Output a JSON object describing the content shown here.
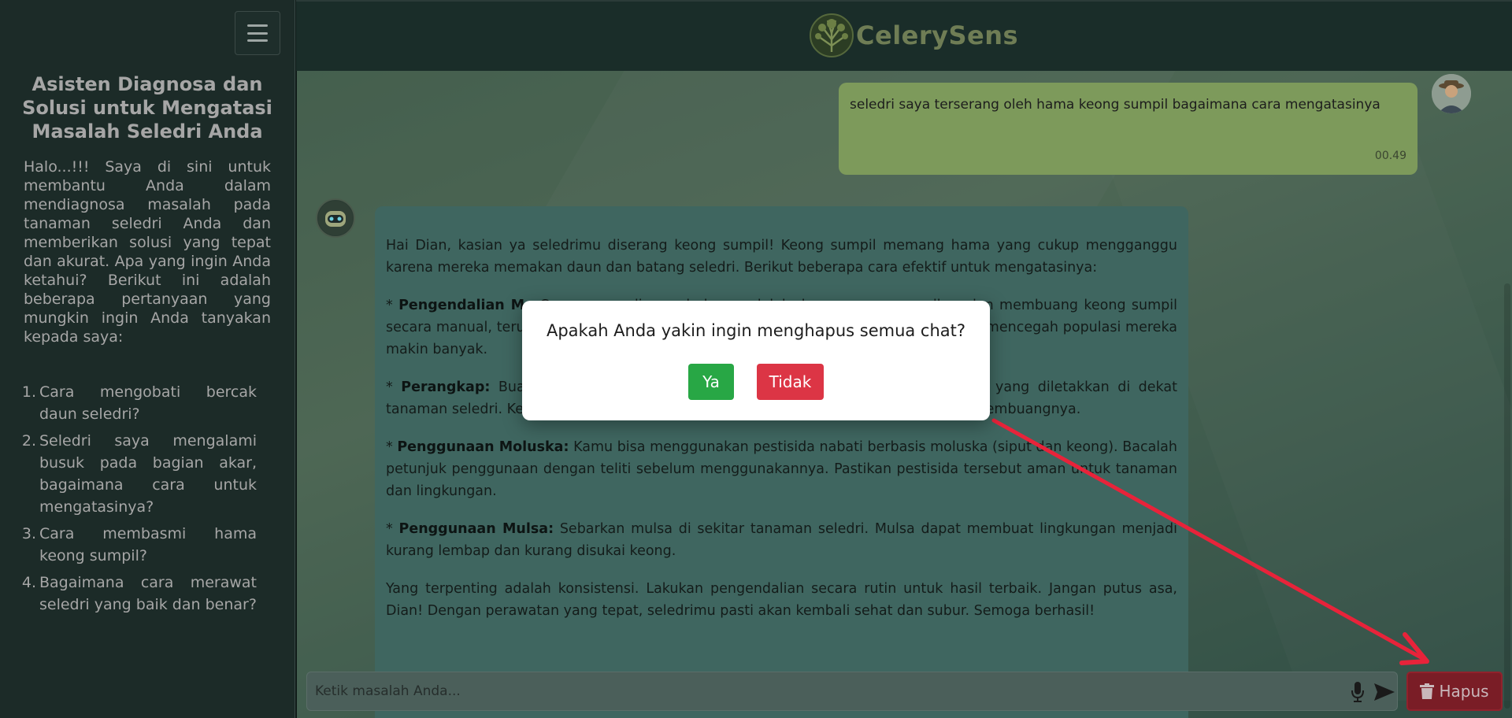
{
  "sidebar": {
    "title": "Asisten Diagnosa dan Solusi untuk Mengatasi Masalah Seledri Anda",
    "intro": "Halo...!!! Saya di sini untuk membantu Anda dalam mendiagnosa masalah pada tanaman seledri Anda dan memberikan solusi yang tepat dan akurat. Apa yang ingin Anda ketahui? Berikut ini adalah beberapa pertanyaan yang mungkin ingin Anda tanyakan kepada saya:",
    "questions": [
      {
        "num": "1.",
        "text": "Cara mengobati bercak daun seledri?"
      },
      {
        "num": "2.",
        "text": "Seledri saya mengalami busuk pada bagian akar, bagaimana cara untuk mengatasinya?"
      },
      {
        "num": "3.",
        "text": "Cara membasmi hama keong sumpil?"
      },
      {
        "num": "4.",
        "text": "Bagaimana cara merawat seledri yang baik dan benar?"
      }
    ]
  },
  "header": {
    "logo_text": "CelerySens"
  },
  "chat": {
    "user_message": "seledri saya terserang oleh hama keong sumpil bagaimana cara mengatasinya",
    "user_time": "00.49",
    "bot_intro": "Hai Dian, kasian ya seledrimu diserang keong sumpil! Keong sumpil memang hama yang cukup mengganggu karena mereka memakan daun dan batang seledri. Berikut beberapa cara efektif untuk mengatasinya:",
    "bot_items": [
      {
        "label": "Pengendalian Ma",
        "text": "Cara yang paling sederhana adalah dengan mengumpulkan dan membuang keong sumpil secara manual, terutama pada malam hari atau pagi hari. Lakukan secara rutin untuk mencegah populasi mereka makin banyak."
      },
      {
        "label": "Perangkap:",
        "text": "Buat perangkap dari bahan bekas seperti kulit jeruk atau sayuran yang diletakkan di dekat tanaman seledri. Keong akan berkumpul di sana dan kamu bisa mengumpulkan dan membuangnya."
      },
      {
        "label": "Penggunaan Moluska:",
        "text": "Kamu bisa menggunakan pestisida nabati berbasis moluska (siput dan keong). Bacalah petunjuk penggunaan dengan teliti sebelum menggunakannya. Pastikan pestisida tersebut aman untuk tanaman dan lingkungan."
      },
      {
        "label": "Penggunaan Mulsa:",
        "text": "Sebarkan mulsa di sekitar tanaman seledri. Mulsa dapat membuat lingkungan menjadi kurang lembap dan kurang disukai keong."
      }
    ],
    "bot_outro": "Yang terpenting adalah konsistensi. Lakukan pengendalian secara rutin untuk hasil terbaik. Jangan putus asa, Dian! Dengan perawatan yang tepat, seledrimu pasti akan kembali sehat dan subur. Semoga berhasil!"
  },
  "input": {
    "placeholder": "Ketik masalah Anda..."
  },
  "hapus_label": "Hapus",
  "modal": {
    "message": "Apakah Anda yakin ingin menghapus semua chat?",
    "yes_label": "Ya",
    "no_label": "Tidak"
  },
  "colors": {
    "yes": "#28a745",
    "no": "#dc3545",
    "arrow": "#e8233a"
  }
}
